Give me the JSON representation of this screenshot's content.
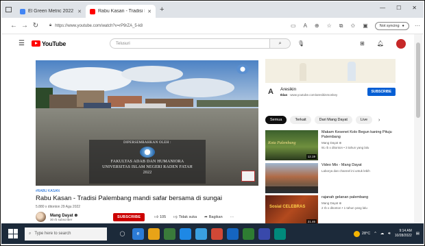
{
  "browser": {
    "tabs": [
      {
        "title": "El Green Metric 2022 - Google",
        "favicon_color": "#4285f4",
        "active": false
      },
      {
        "title": "Rabu Kasan - Tradisi Pale...",
        "favicon_color": "#ff0000",
        "active": true
      }
    ],
    "new_tab": "+",
    "url": "https://www.youtube.com/watch?v=rP9rZA_5-k8",
    "not_syncing": "Not syncing"
  },
  "youtube": {
    "logo_text": "YouTube",
    "search_placeholder": "Telusuri"
  },
  "video": {
    "overlay_line1": "DIPERSEMBAHKAN OLEH :",
    "overlay_line2": "FAKULTAS ADAB DAN HUMANIORA",
    "overlay_line3": "UNIVERSITAS ISLAM NEGERI RADEN FATAH",
    "overlay_line4": "2022",
    "hashtag": "#RABU KASAN",
    "title": "Rabu Kasan - Tradisi Palembang mandi safar bersama di sungai",
    "meta": "5.880 x ditonton  29 Agu 2022",
    "channel_name": "Mang Dayat ⊛",
    "channel_subs": "30 rb subscriber",
    "subscribe": "SUBSCRIBE",
    "likes": "105",
    "dislike": "Tidak suka",
    "share": "Bagikan",
    "more": "···"
  },
  "ad": {
    "logo": "A",
    "name": "Aresikin",
    "label": "Iklan",
    "url": "www.youtube.com/aresikinmonkey",
    "button": "SUBSCRIBE"
  },
  "chips": [
    "Semua",
    "Terkait",
    "Dari Mang Dayat",
    "Live"
  ],
  "recommendations": [
    {
      "title": "Makam Kesenet Kolo Begun kaning Pituju Palembang",
      "channel": "Mang Dayat ⊛",
      "meta": "91 rb x ditonton • 3 tahun yang lalu",
      "duration": "12.19",
      "thumb_text": "Kota Palembang"
    },
    {
      "title": "Video Mix - Mang Dayat",
      "channel": "Laborya dan channel ini untuk lebih",
      "meta": "",
      "duration": "",
      "thumb_text": ""
    },
    {
      "title": "rajanah gelanan palembang",
      "channel": "Mang Dayat ⊛",
      "meta": "2 rb x ditonton • 1 tahun yang lalu",
      "duration": "21.46",
      "thumb_text": "Sosial CELEBRAS"
    }
  ],
  "taskbar": {
    "search_placeholder": "Type here to search",
    "temperature": "28°C",
    "time": "9:14 AM",
    "date": "10/28/2022"
  },
  "colors": {
    "yt_red": "#ff0000",
    "subscribe_red": "#cc0000",
    "ad_blue": "#065fd4",
    "taskbar": "#1c2a3a"
  }
}
